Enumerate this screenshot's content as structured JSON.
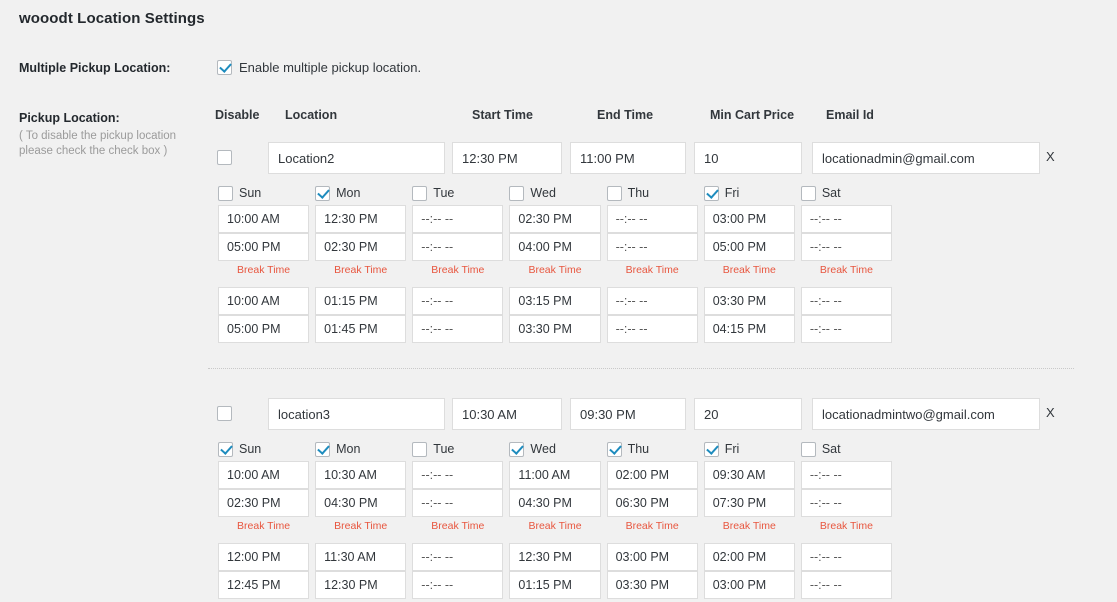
{
  "header": {
    "title": "wooodt Location Settings"
  },
  "colors": {
    "page_background": "#f1f1f1",
    "accent_break": "#e8563f",
    "checkbox_check": "#1e8cbe",
    "input_border": "#dddddd"
  },
  "multiple_pickup": {
    "label": "Multiple Pickup Location:",
    "checkbox_label": "Enable multiple pickup location.",
    "checked": true
  },
  "pickup_location": {
    "label": "Pickup Location:",
    "hint_line1": "( To disable the pickup location",
    "hint_line2": "please check the check box )"
  },
  "column_headers": {
    "disable": "Disable",
    "location": "Location",
    "start_time": "Start Time",
    "end_time": "End Time",
    "min_cart_price": "Min Cart Price",
    "email_id": "Email Id"
  },
  "common": {
    "time_placeholder": "--:-- --",
    "break_time_label": "Break Time",
    "remove_label": "X",
    "day_names": [
      "Sun",
      "Mon",
      "Tue",
      "Wed",
      "Thu",
      "Fri",
      "Sat"
    ]
  },
  "locations": [
    {
      "disabled": false,
      "name": "Location2",
      "start_time": "12:30 PM",
      "end_time": "11:00 PM",
      "min_cart_price": "10",
      "email": "locationadmin@gmail.com",
      "days": [
        {
          "name": "Sun",
          "checked": false,
          "open": "10:00 AM",
          "close": "05:00 PM",
          "break_start": "10:00 AM",
          "break_end": "05:00 PM"
        },
        {
          "name": "Mon",
          "checked": true,
          "open": "12:30 PM",
          "close": "02:30 PM",
          "break_start": "01:15 PM",
          "break_end": "01:45 PM"
        },
        {
          "name": "Tue",
          "checked": false,
          "open": "",
          "close": "",
          "break_start": "",
          "break_end": ""
        },
        {
          "name": "Wed",
          "checked": false,
          "open": "02:30 PM",
          "close": "04:00 PM",
          "break_start": "03:15 PM",
          "break_end": "03:30 PM"
        },
        {
          "name": "Thu",
          "checked": false,
          "open": "",
          "close": "",
          "break_start": "",
          "break_end": ""
        },
        {
          "name": "Fri",
          "checked": true,
          "open": "03:00 PM",
          "close": "05:00 PM",
          "break_start": "03:30 PM",
          "break_end": "04:15 PM"
        },
        {
          "name": "Sat",
          "checked": false,
          "open": "",
          "close": "",
          "break_start": "",
          "break_end": ""
        }
      ]
    },
    {
      "disabled": false,
      "name": "location3",
      "start_time": "10:30 AM",
      "end_time": "09:30 PM",
      "min_cart_price": "20",
      "email": "locationadmintwo@gmail.com",
      "days": [
        {
          "name": "Sun",
          "checked": true,
          "open": "10:00 AM",
          "close": "02:30 PM",
          "break_start": "12:00 PM",
          "break_end": "12:45 PM"
        },
        {
          "name": "Mon",
          "checked": true,
          "open": "10:30 AM",
          "close": "04:30 PM",
          "break_start": "11:30 AM",
          "break_end": "12:30 PM"
        },
        {
          "name": "Tue",
          "checked": false,
          "open": "",
          "close": "",
          "break_start": "",
          "break_end": ""
        },
        {
          "name": "Wed",
          "checked": true,
          "open": "11:00 AM",
          "close": "04:30 PM",
          "break_start": "12:30 PM",
          "break_end": "01:15 PM"
        },
        {
          "name": "Thu",
          "checked": true,
          "open": "02:00 PM",
          "close": "06:30 PM",
          "break_start": "03:00 PM",
          "break_end": "03:30 PM"
        },
        {
          "name": "Fri",
          "checked": true,
          "open": "09:30 AM",
          "close": "07:30 PM",
          "break_start": "02:00 PM",
          "break_end": "03:00 PM"
        },
        {
          "name": "Sat",
          "checked": false,
          "open": "",
          "close": "",
          "break_start": "",
          "break_end": ""
        }
      ]
    }
  ]
}
